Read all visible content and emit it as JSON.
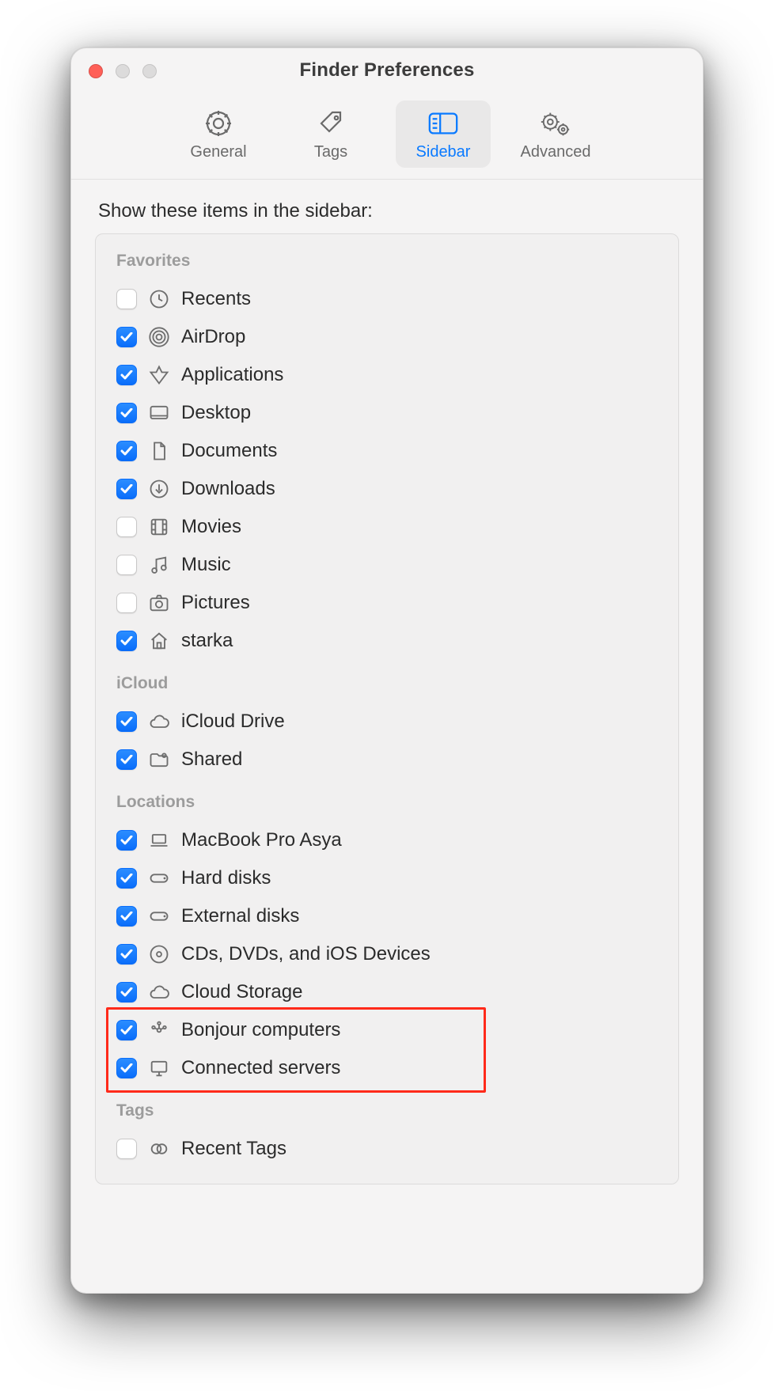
{
  "window": {
    "title": "Finder Preferences"
  },
  "tabs": {
    "general": {
      "label": "General",
      "selected": false
    },
    "tags": {
      "label": "Tags",
      "selected": false
    },
    "sidebar": {
      "label": "Sidebar",
      "selected": true
    },
    "advanced": {
      "label": "Advanced",
      "selected": false
    }
  },
  "prompt": "Show these items in the sidebar:",
  "sections": {
    "favorites": {
      "header": "Favorites",
      "items": [
        {
          "label": "Recents",
          "checked": false
        },
        {
          "label": "AirDrop",
          "checked": true
        },
        {
          "label": "Applications",
          "checked": true
        },
        {
          "label": "Desktop",
          "checked": true
        },
        {
          "label": "Documents",
          "checked": true
        },
        {
          "label": "Downloads",
          "checked": true
        },
        {
          "label": "Movies",
          "checked": false
        },
        {
          "label": "Music",
          "checked": false
        },
        {
          "label": "Pictures",
          "checked": false
        },
        {
          "label": "starka",
          "checked": true
        }
      ]
    },
    "icloud": {
      "header": "iCloud",
      "items": [
        {
          "label": "iCloud Drive",
          "checked": true
        },
        {
          "label": "Shared",
          "checked": true
        }
      ]
    },
    "locations": {
      "header": "Locations",
      "items": [
        {
          "label": "MacBook Pro Asya",
          "checked": true
        },
        {
          "label": "Hard disks",
          "checked": true
        },
        {
          "label": "External disks",
          "checked": true
        },
        {
          "label": "CDs, DVDs, and iOS Devices",
          "checked": true
        },
        {
          "label": "Cloud Storage",
          "checked": true
        },
        {
          "label": "Bonjour computers",
          "checked": true
        },
        {
          "label": "Connected servers",
          "checked": true
        }
      ]
    },
    "tags": {
      "header": "Tags",
      "items": [
        {
          "label": "Recent Tags",
          "checked": false
        }
      ]
    }
  },
  "highlight": {
    "description": "red annotation box around Bonjour computers and Connected servers rows"
  }
}
